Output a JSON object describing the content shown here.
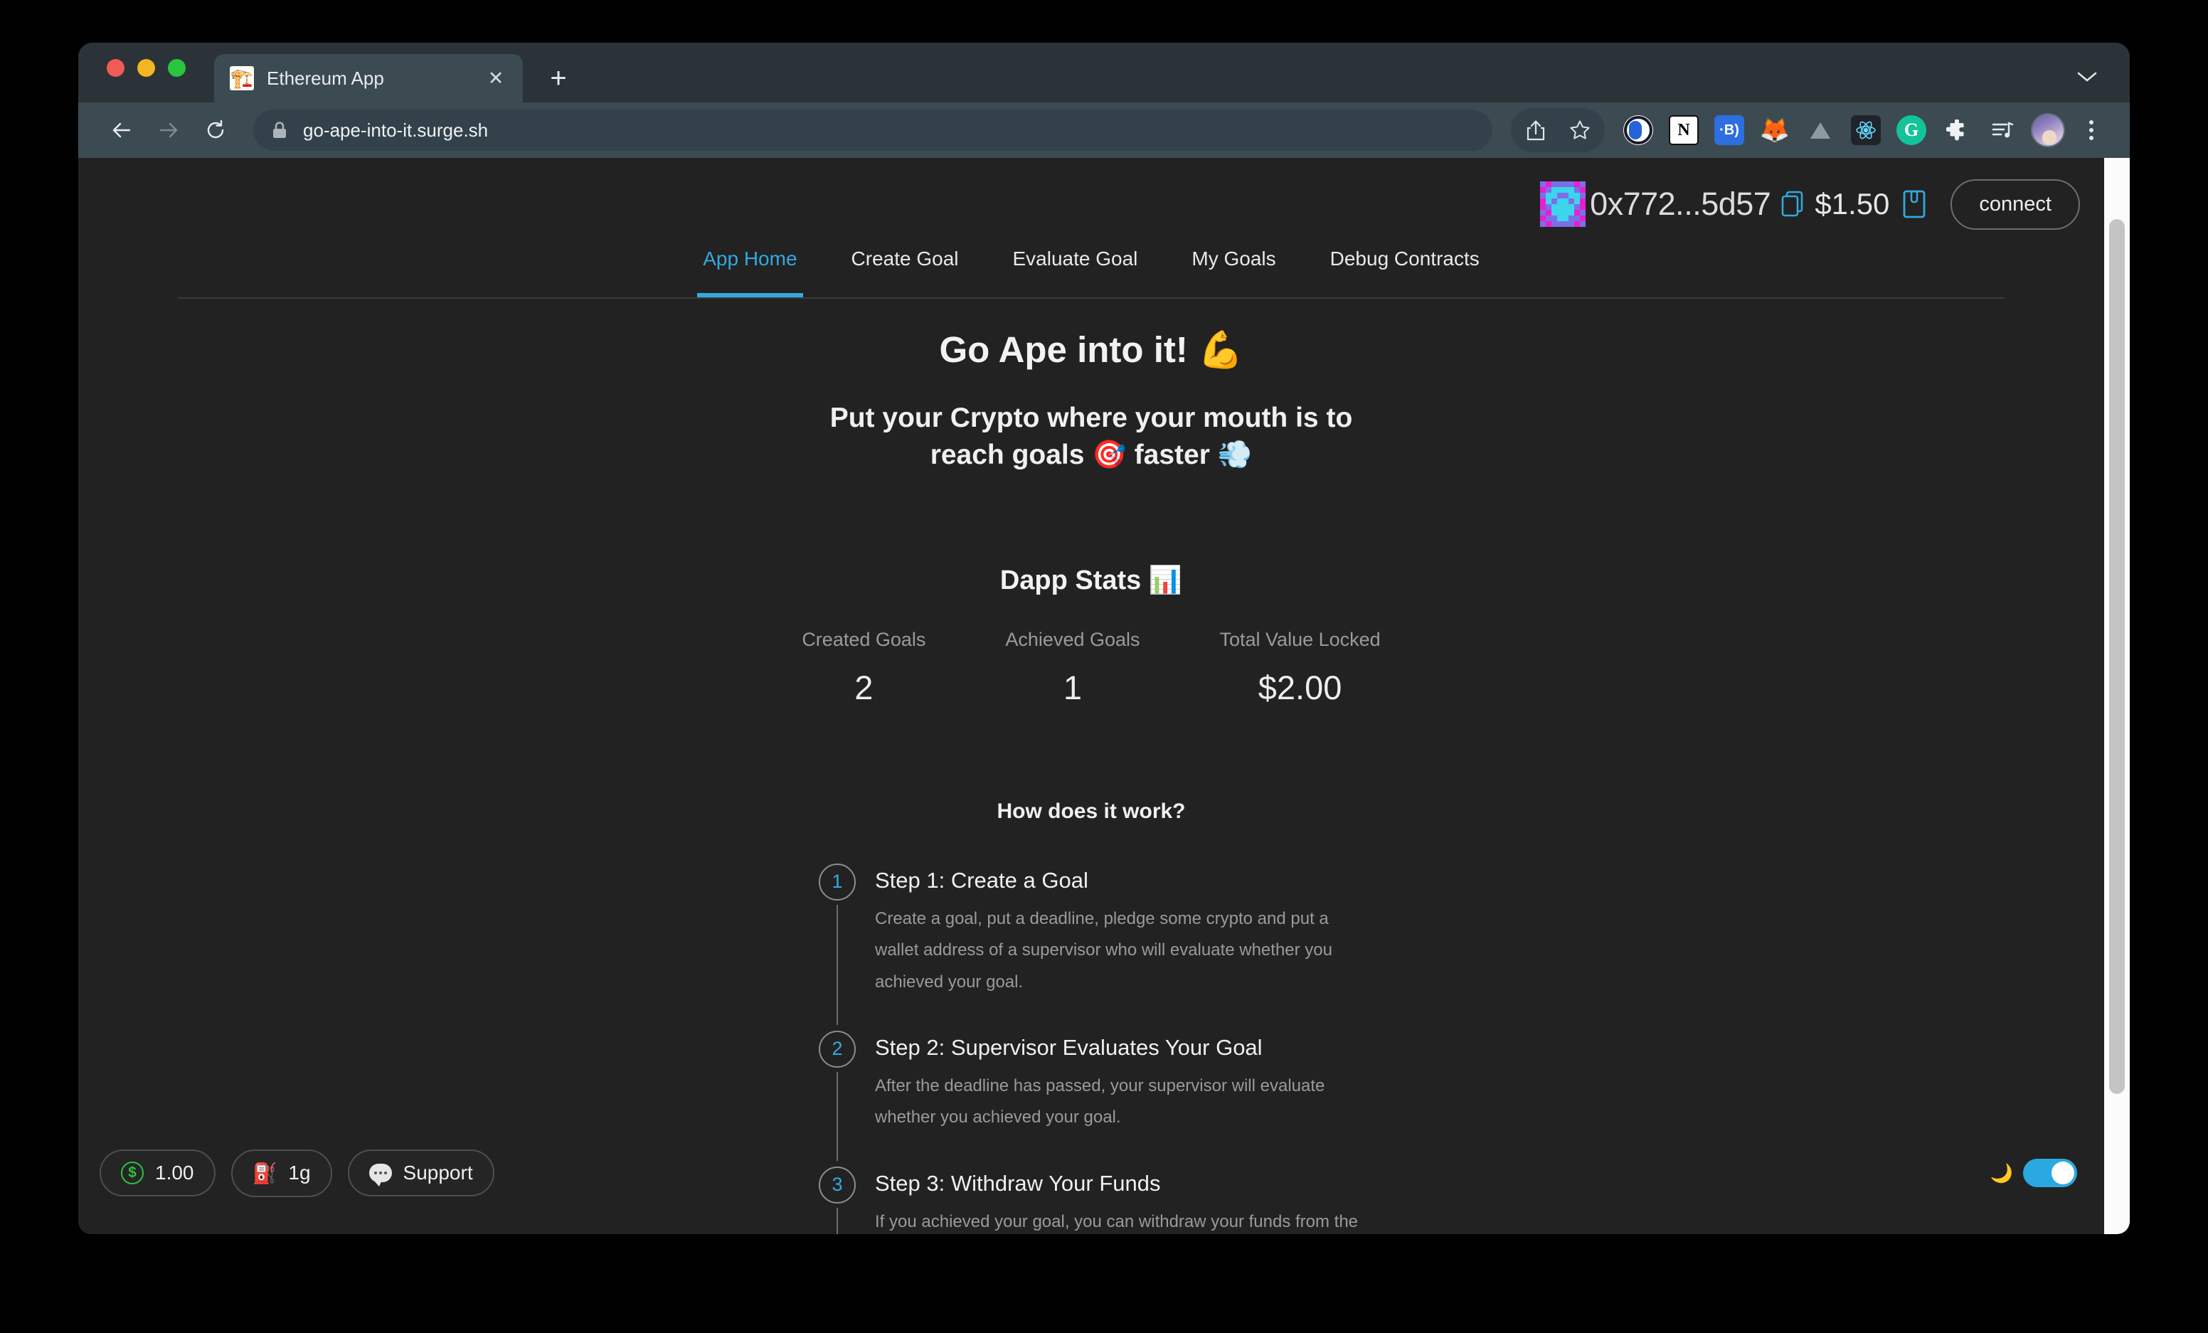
{
  "browser": {
    "tab": {
      "title": "Ethereum App",
      "favicon": "🏗️",
      "close_label": "✕"
    },
    "new_tab_label": "+",
    "url": "go-ape-into-it.surge.sh",
    "toolbar_icons": [
      "share-icon",
      "bookmark-star-icon",
      "1password-icon",
      "notion-icon",
      "bitwarden-icon",
      "metamask-icon",
      "vercel-icon",
      "react-devtools-icon",
      "grammarly-icon",
      "extensions-puzzle-icon",
      "reading-list-icon",
      "profile-avatar",
      "chrome-menu-icon"
    ]
  },
  "dapp_header": {
    "address": "0x772...5d57",
    "balance": "$1.50",
    "connect_label": "connect",
    "copy_icon": "copy-icon",
    "qr_icon": "wallet-qr-icon",
    "blockie_colors": [
      "#7b6fe8",
      "#e81fd0",
      "#3dd5ec"
    ],
    "blockie_grid": [
      [
        0,
        1,
        0,
        0,
        0,
        0,
        1,
        0
      ],
      [
        1,
        0,
        2,
        2,
        2,
        2,
        0,
        1
      ],
      [
        0,
        2,
        2,
        0,
        0,
        2,
        2,
        0
      ],
      [
        1,
        2,
        0,
        2,
        2,
        0,
        2,
        1
      ],
      [
        1,
        0,
        2,
        2,
        2,
        2,
        0,
        1
      ],
      [
        0,
        1,
        2,
        2,
        2,
        2,
        1,
        0
      ],
      [
        1,
        0,
        0,
        2,
        2,
        0,
        0,
        1
      ],
      [
        0,
        1,
        0,
        0,
        0,
        0,
        1,
        0
      ]
    ]
  },
  "nav": {
    "items": [
      {
        "label": "App Home",
        "active": true
      },
      {
        "label": "Create Goal",
        "active": false
      },
      {
        "label": "Evaluate Goal",
        "active": false
      },
      {
        "label": "My Goals",
        "active": false
      },
      {
        "label": "Debug Contracts",
        "active": false
      }
    ]
  },
  "hero": {
    "title": "Go Ape into it! 💪",
    "subtitle": "Put your Crypto where your mouth is to reach goals 🎯 faster 💨"
  },
  "stats": {
    "title": "Dapp Stats 📊",
    "items": [
      {
        "label": "Created Goals",
        "value": "2"
      },
      {
        "label": "Achieved Goals",
        "value": "1"
      },
      {
        "label": "Total Value Locked",
        "value": "$2.00"
      }
    ]
  },
  "how_it_works": {
    "title": "How does it work?",
    "steps": [
      {
        "number": "1",
        "title": "Step 1: Create a Goal",
        "description": "Create a goal, put a deadline, pledge some crypto and put a wallet address of a supervisor who will evaluate whether you achieved your goal."
      },
      {
        "number": "2",
        "title": "Step 2: Supervisor Evaluates Your Goal",
        "description": "After the deadline has passed, your supervisor will evaluate whether you achieved your goal."
      },
      {
        "number": "3",
        "title": "Step 3: Withdraw Your Funds",
        "description": "If you achieved your goal, you can withdraw your funds from the smart contract. Otherwise, your funds are locked and you"
      }
    ]
  },
  "bottom_bar": {
    "price_pill": {
      "icon": "dollar-circle-icon",
      "label": "1.00"
    },
    "gas_pill": {
      "icon": "gas-pump-icon",
      "label": "1g"
    },
    "support_pill": {
      "icon": "speech-bubble-icon",
      "label": "Support"
    },
    "dark_mode": {
      "icon": "moon-icon",
      "enabled": true
    }
  },
  "colors": {
    "accent": "#34a9df",
    "page_bg": "#222222",
    "chrome_tabstrip": "#2b3338",
    "chrome_toolbar": "#3c4a52"
  }
}
